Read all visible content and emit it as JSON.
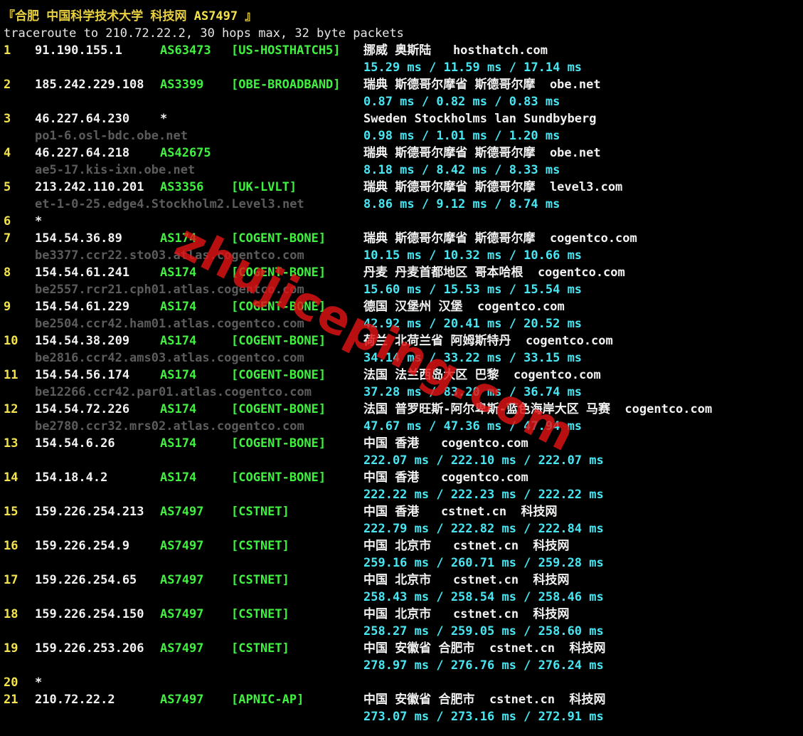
{
  "header": {
    "title_open": "『合肥 中国科学技术大学 科技网 ",
    "title_as": "AS7497",
    "title_close": " 』",
    "command": "traceroute to 210.72.22.2, 30 hops max, 32 byte packets"
  },
  "watermark": "zhujiceping.com",
  "colors": {
    "hop_number": "#f5e34a",
    "ip": "#f2f2f2",
    "asn": "#3ff23f",
    "latency": "#47e6f2",
    "hostname": "#5c5c5c",
    "watermark": "#e11414"
  },
  "hops": [
    {
      "num": "1",
      "ip": "91.190.155.1",
      "asn": "AS63473",
      "org": "[US-HOSTHATCH5]",
      "geo": "挪威 奥斯陆   hosthatch.com",
      "rdns": "",
      "rtt": "15.29 ms / 11.59 ms / 17.14 ms"
    },
    {
      "num": "2",
      "ip": "185.242.229.108",
      "asn": "AS3399",
      "org": "[OBE-BROADBAND]",
      "geo": "瑞典 斯德哥尔摩省 斯德哥尔摩  obe.net",
      "rdns": "",
      "rtt": "0.87 ms / 0.82 ms / 0.83 ms"
    },
    {
      "num": "3",
      "ip": "46.227.64.230",
      "asn": "*",
      "org": "",
      "geo": "Sweden Stockholms lan Sundbyberg",
      "rdns": "po1-6.osl-bdc.obe.net",
      "rtt": "0.98 ms / 1.01 ms / 1.20 ms"
    },
    {
      "num": "4",
      "ip": "46.227.64.218",
      "asn": "AS42675",
      "org": "",
      "geo": "瑞典 斯德哥尔摩省 斯德哥尔摩  obe.net",
      "rdns": "ae5-17.kis-ixn.obe.net",
      "rtt": "8.18 ms / 8.42 ms / 8.33 ms"
    },
    {
      "num": "5",
      "ip": "213.242.110.201",
      "asn": "AS3356",
      "org": "[UK-LVLT]",
      "geo": "瑞典 斯德哥尔摩省 斯德哥尔摩  level3.com",
      "rdns": "et-1-0-25.edge4.Stockholm2.Level3.net",
      "rtt": "8.86 ms / 9.12 ms / 8.74 ms"
    },
    {
      "num": "6",
      "ip": "*",
      "asn": "",
      "org": "",
      "geo": "",
      "rdns": "",
      "rtt": ""
    },
    {
      "num": "7",
      "ip": "154.54.36.89",
      "asn": "AS174",
      "org": "[COGENT-BONE]",
      "geo": "瑞典 斯德哥尔摩省 斯德哥尔摩  cogentco.com",
      "rdns": "be3377.ccr22.sto03.atlas.cogentco.com",
      "rtt": "10.15 ms / 10.32 ms / 10.66 ms"
    },
    {
      "num": "8",
      "ip": "154.54.61.241",
      "asn": "AS174",
      "org": "[COGENT-BONE]",
      "geo": "丹麦 丹麦首都地区 哥本哈根  cogentco.com",
      "rdns": "be2557.rcr21.cph01.atlas.cogentco.com",
      "rtt": "15.60 ms / 15.53 ms / 15.54 ms"
    },
    {
      "num": "9",
      "ip": "154.54.61.229",
      "asn": "AS174",
      "org": "[COGENT-BONE]",
      "geo": "德国 汉堡州 汉堡  cogentco.com",
      "rdns": "be2504.ccr42.ham01.atlas.cogentco.com",
      "rtt": "42.92 ms / 20.41 ms / 20.52 ms"
    },
    {
      "num": "10",
      "ip": "154.54.38.209",
      "asn": "AS174",
      "org": "[COGENT-BONE]",
      "geo": "荷兰 北荷兰省 阿姆斯特丹  cogentco.com",
      "rdns": "be2816.ccr42.ams03.atlas.cogentco.com",
      "rtt": "34.14 ms / 33.22 ms / 33.15 ms"
    },
    {
      "num": "11",
      "ip": "154.54.56.174",
      "asn": "AS174",
      "org": "[COGENT-BONE]",
      "geo": "法国 法兰西岛大区 巴黎  cogentco.com",
      "rdns": "be12266.ccr42.par01.atlas.cogentco.com",
      "rtt": "37.28 ms / 83.20 ms / 36.74 ms"
    },
    {
      "num": "12",
      "ip": "154.54.72.226",
      "asn": "AS174",
      "org": "[COGENT-BONE]",
      "geo": "法国 普罗旺斯-阿尔卑斯-蓝色海岸大区 马赛  cogentco.com",
      "rdns": "be2780.ccr32.mrs02.atlas.cogentco.com",
      "rtt": "47.67 ms / 47.36 ms / 47.94 ms"
    },
    {
      "num": "13",
      "ip": "154.54.6.26",
      "asn": "AS174",
      "org": "[COGENT-BONE]",
      "geo": "中国 香港   cogentco.com",
      "rdns": "",
      "rtt": "222.07 ms / 222.10 ms / 222.07 ms"
    },
    {
      "num": "14",
      "ip": "154.18.4.2",
      "asn": "AS174",
      "org": "[COGENT-BONE]",
      "geo": "中国 香港   cogentco.com",
      "rdns": "",
      "rtt": "222.22 ms / 222.23 ms / 222.22 ms"
    },
    {
      "num": "15",
      "ip": "159.226.254.213",
      "asn": "AS7497",
      "org": "[CSTNET]",
      "geo": "中国 香港   cstnet.cn  科技网",
      "rdns": "",
      "rtt": "222.79 ms / 222.82 ms / 222.84 ms"
    },
    {
      "num": "16",
      "ip": "159.226.254.9",
      "asn": "AS7497",
      "org": "[CSTNET]",
      "geo": "中国 北京市   cstnet.cn  科技网",
      "rdns": "",
      "rtt": "259.16 ms / 260.71 ms / 259.28 ms"
    },
    {
      "num": "17",
      "ip": "159.226.254.65",
      "asn": "AS7497",
      "org": "[CSTNET]",
      "geo": "中国 北京市   cstnet.cn  科技网",
      "rdns": "",
      "rtt": "258.43 ms / 258.54 ms / 258.46 ms"
    },
    {
      "num": "18",
      "ip": "159.226.254.150",
      "asn": "AS7497",
      "org": "[CSTNET]",
      "geo": "中国 北京市   cstnet.cn  科技网",
      "rdns": "",
      "rtt": "258.27 ms / 259.05 ms / 258.60 ms"
    },
    {
      "num": "19",
      "ip": "159.226.253.206",
      "asn": "AS7497",
      "org": "[CSTNET]",
      "geo": "中国 安徽省 合肥市  cstnet.cn  科技网",
      "rdns": "",
      "rtt": "278.97 ms / 276.76 ms / 276.24 ms"
    },
    {
      "num": "20",
      "ip": "*",
      "asn": "",
      "org": "",
      "geo": "",
      "rdns": "",
      "rtt": ""
    },
    {
      "num": "21",
      "ip": "210.72.22.2",
      "asn": "AS7497",
      "org": "[APNIC-AP]",
      "geo": "中国 安徽省 合肥市  cstnet.cn  科技网",
      "rdns": "",
      "rtt": "273.07 ms / 273.16 ms / 272.91 ms"
    }
  ]
}
